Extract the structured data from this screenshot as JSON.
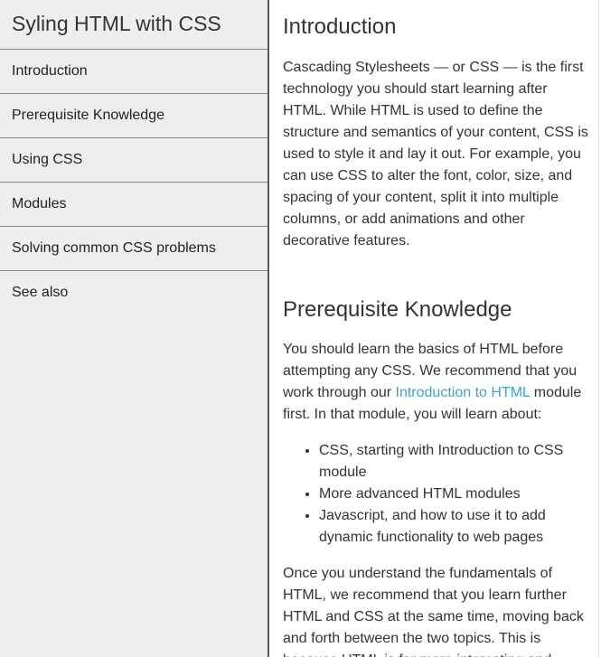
{
  "sidebar": {
    "title": "Syling HTML with CSS",
    "items": [
      {
        "label": "Introduction"
      },
      {
        "label": "Prerequisite Knowledge"
      },
      {
        "label": "Using CSS"
      },
      {
        "label": "Modules"
      },
      {
        "label": "Solving common CSS problems"
      },
      {
        "label": "See also"
      }
    ]
  },
  "main": {
    "intro": {
      "heading": "Introduction",
      "paragraph": "Cascading Stylesheets — or CSS — is the first technology you should start learning after HTML. While HTML is used to define the structure and semantics of your content, CSS is used to style it and lay it out. For example, you can use CSS to alter the font, color, size, and spacing of your content, split it into multiple columns, or add animations and other decorative features."
    },
    "prereq": {
      "heading": "Prerequisite Knowledge",
      "paragraph_before": "You should learn the basics of HTML before attempting any CSS. We recommend that you work through our ",
      "link_text": "Introduction to HTML",
      "paragraph_after": " module first. In that module, you will learn about:",
      "bullets": [
        "CSS, starting with Introduction to CSS module",
        "More advanced HTML modules",
        "Javascript, and how to use it to add dynamic functionality to web pages"
      ],
      "paragraph2": "Once you understand the fundamentals of HTML, we recommend that you learn further HTML and CSS at the same time, moving back and forth between the two topics. This is because HTML is far more interesting and"
    }
  },
  "colors": {
    "sidebar_bg": "#eeeeee",
    "link": "#3aa3d1",
    "text": "#333333"
  }
}
